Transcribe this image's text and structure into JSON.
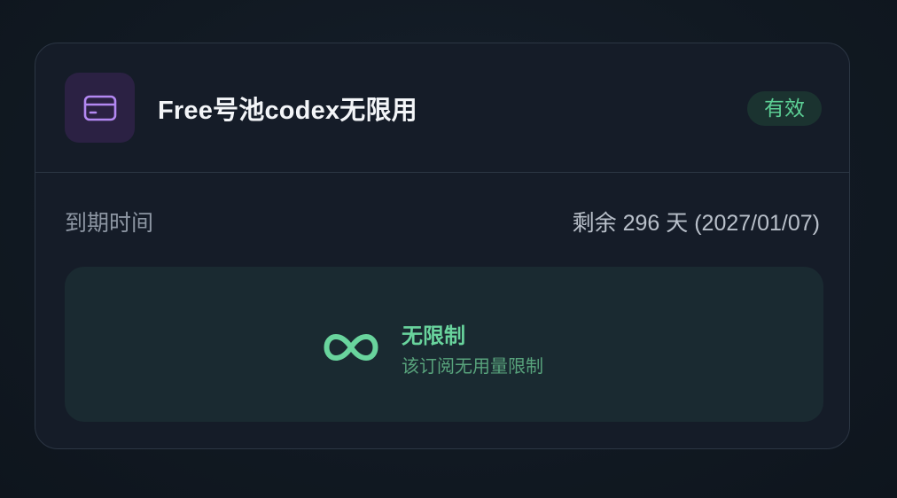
{
  "plan": {
    "title": "Free号池codex无限用",
    "status": "有效",
    "icon": "credit-card-icon"
  },
  "expiry": {
    "label": "到期时间",
    "value": "剩余 296 天 (2027/01/07)"
  },
  "usage": {
    "icon": "infinity-icon",
    "title": "无限制",
    "description": "该订阅无用量限制"
  },
  "colors": {
    "accent_purple": "#b388f2",
    "accent_green": "#5ccf95",
    "card_background": "#151c28",
    "page_background": "#111922"
  }
}
